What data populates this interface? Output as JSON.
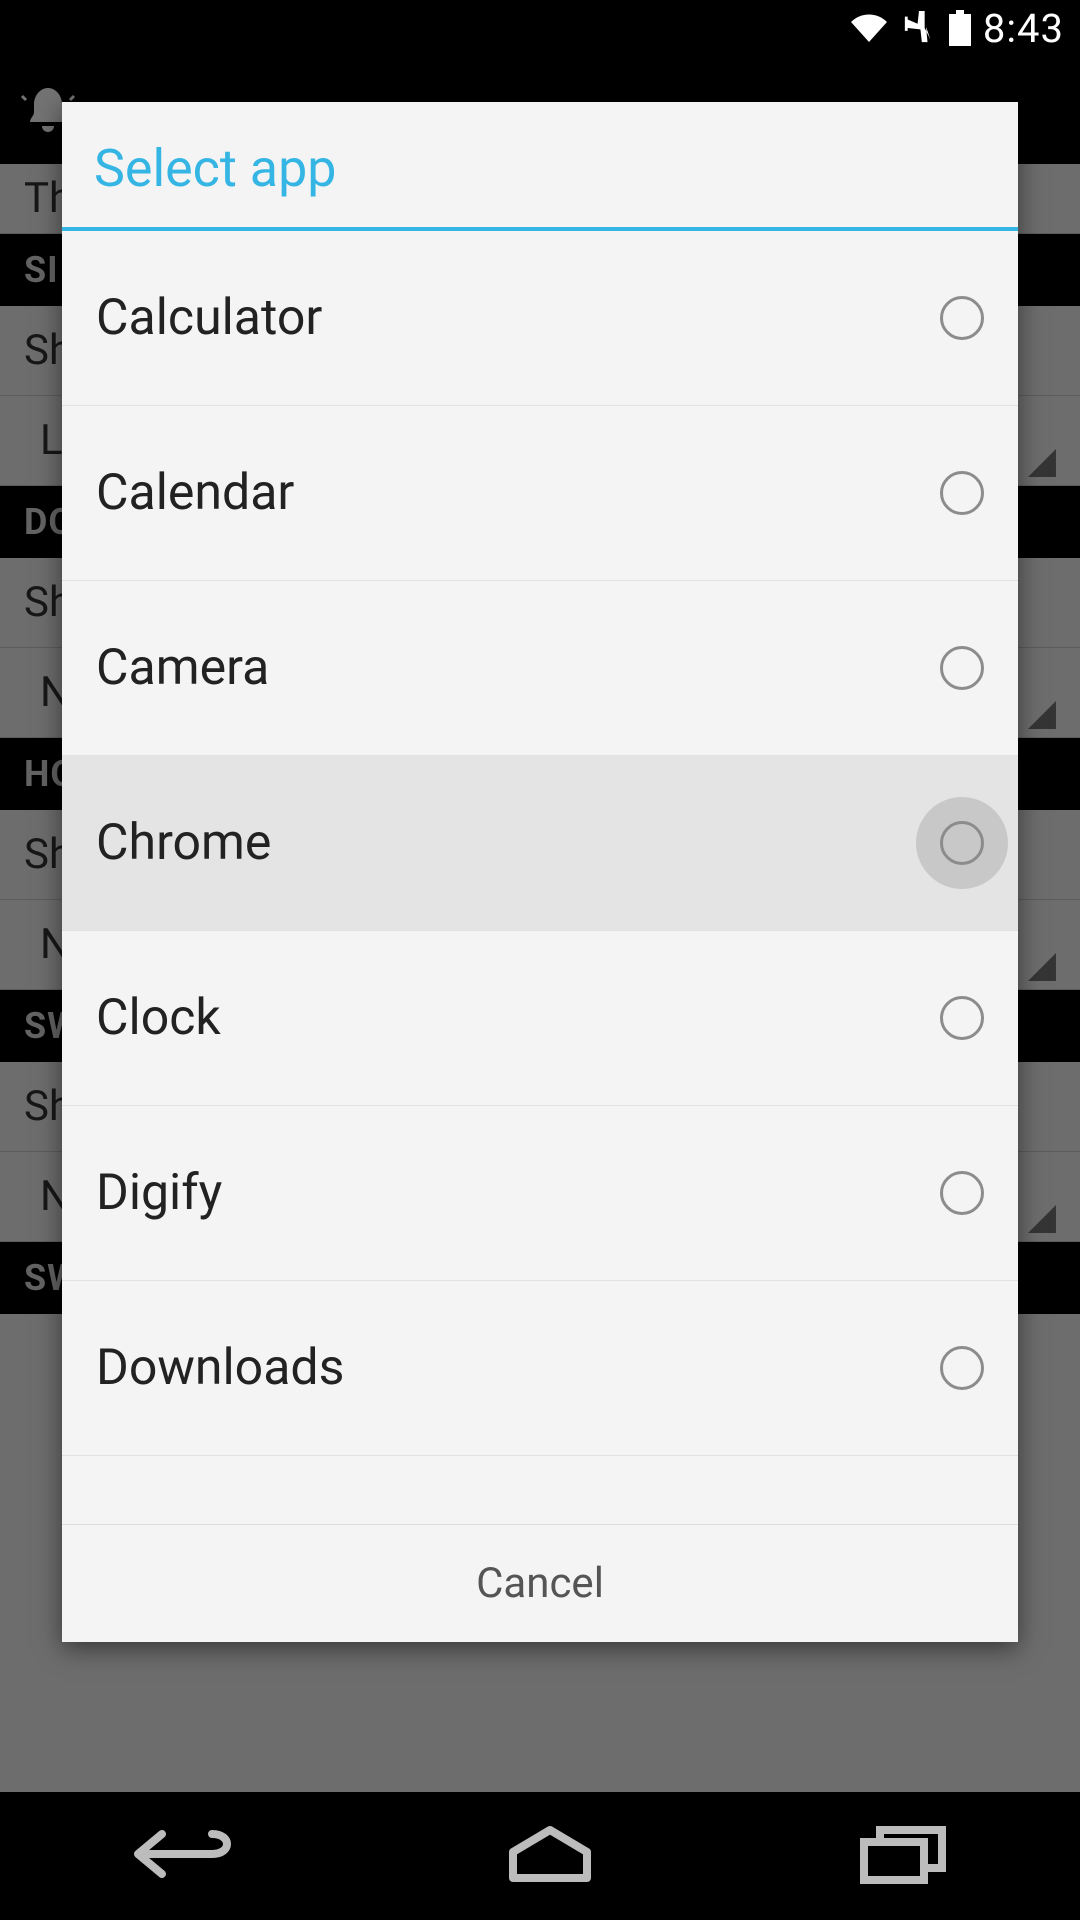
{
  "status_bar": {
    "time": "8:43"
  },
  "background": {
    "title_hint": "Thi",
    "sections": [
      {
        "header": "SI",
        "rows": [
          "Sho",
          "La"
        ]
      },
      {
        "header": "DO",
        "rows": [
          "Sho",
          "No"
        ]
      },
      {
        "header": "HO",
        "rows": [
          "Sho",
          "No"
        ]
      },
      {
        "header": "SW",
        "rows": [
          "Sho",
          "No"
        ]
      },
      {
        "header": "SW",
        "rows": []
      }
    ]
  },
  "dialog": {
    "title": "Select app",
    "apps": [
      {
        "name": "Calculator",
        "highlighted": false,
        "pressed": false
      },
      {
        "name": "Calendar",
        "highlighted": false,
        "pressed": false
      },
      {
        "name": "Camera",
        "highlighted": false,
        "pressed": false
      },
      {
        "name": "Chrome",
        "highlighted": true,
        "pressed": true
      },
      {
        "name": "Clock",
        "highlighted": false,
        "pressed": false
      },
      {
        "name": "Digify",
        "highlighted": false,
        "pressed": false
      },
      {
        "name": "Downloads",
        "highlighted": false,
        "pressed": false
      }
    ],
    "cancel_label": "Cancel"
  }
}
